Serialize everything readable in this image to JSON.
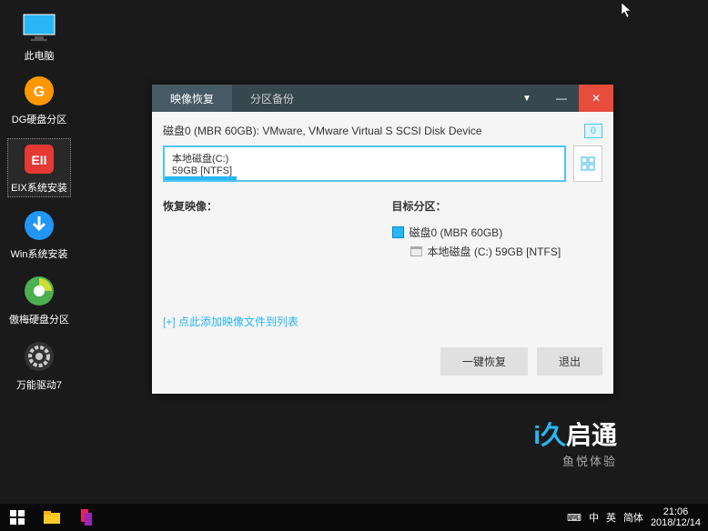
{
  "desktop": {
    "icons": [
      {
        "label": "此电脑"
      },
      {
        "label": "DG硬盘分区"
      },
      {
        "label": "EIX系统安装"
      },
      {
        "label": "Win系统安装"
      },
      {
        "label": "傲梅硬盘分区"
      },
      {
        "label": "万能驱动7"
      }
    ]
  },
  "window": {
    "tabs": {
      "active": "映像恢复",
      "inactive": "分区备份"
    },
    "disk_line": "磁盘0 (MBR 60GB): VMware, VMware Virtual S SCSI Disk Device",
    "disk_badge": "0",
    "partition": {
      "name": "本地磁盘(C:)",
      "size": "59GB [NTFS]"
    },
    "sections": {
      "restore_title": "恢复映像：",
      "target_title": "目标分区：",
      "tree": {
        "disk": "磁盘0 (MBR 60GB)",
        "part": "本地磁盘 (C:) 59GB [NTFS]"
      }
    },
    "add_link": "[+] 点此添加映像文件到列表",
    "buttons": {
      "restore": "一键恢复",
      "exit": "退出"
    }
  },
  "brand": {
    "prefix": "i久",
    "main": "启通",
    "sub": "鱼悦体验"
  },
  "taskbar": {
    "ime": {
      "zh": "中",
      "en": "英",
      "mode": "简体"
    },
    "time": "21:06",
    "date": "2018/12/14"
  }
}
